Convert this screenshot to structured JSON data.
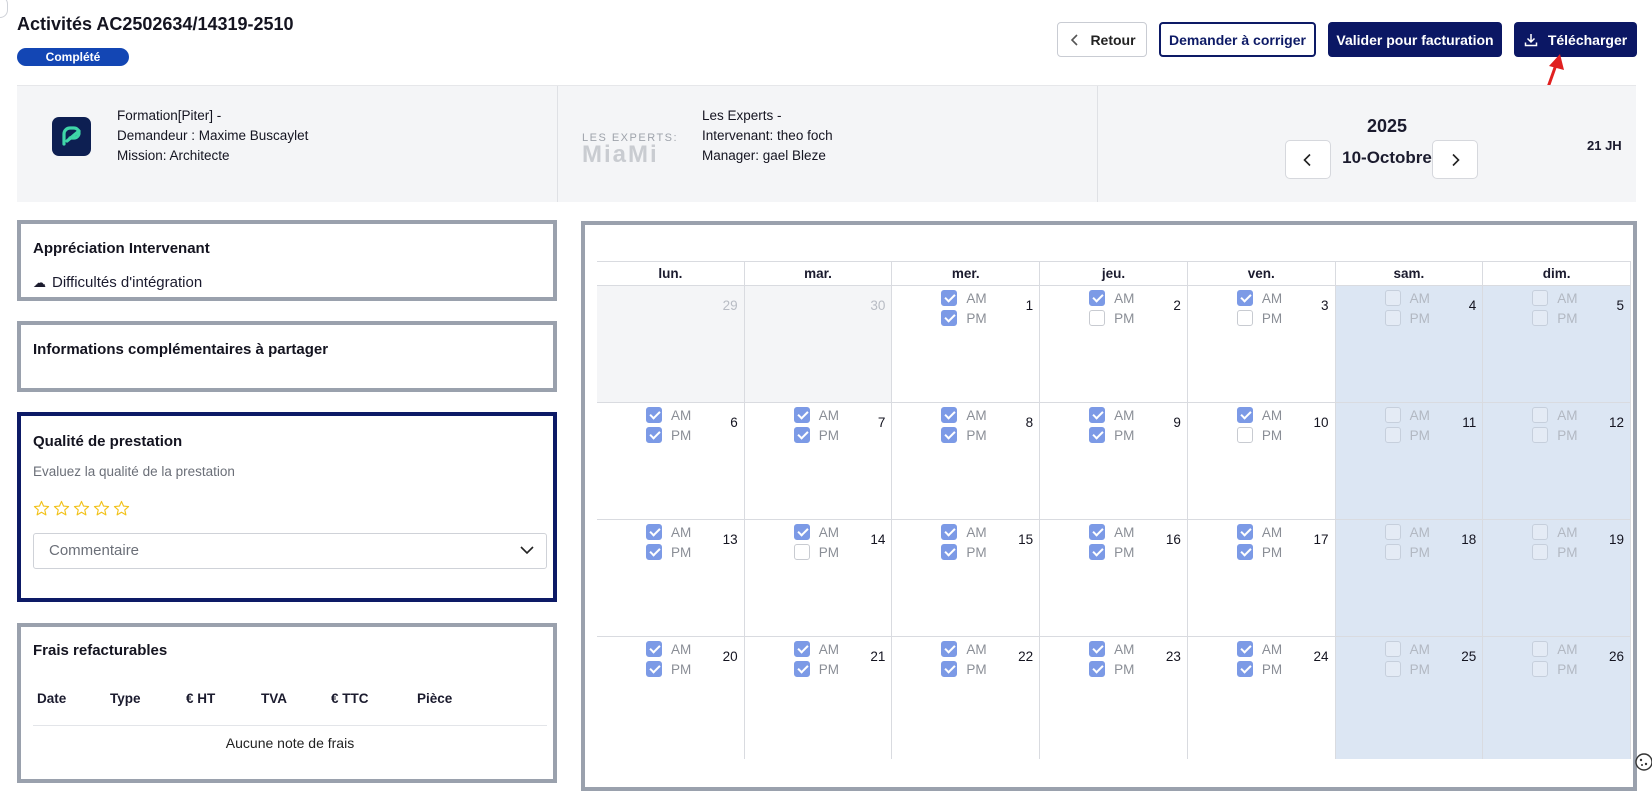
{
  "header": {
    "title": "Activités AC2502634/14319-2510",
    "status": "Complété",
    "buttons": {
      "retour": "Retour",
      "corriger": "Demander à corriger",
      "valider": "Valider pour facturation",
      "telecharger": "Télécharger"
    }
  },
  "info": {
    "client": {
      "line1": "Formation[Piter] -",
      "line2": "Demandeur : Maxime Buscaylet",
      "line3": "Mission: Architecte"
    },
    "provider": {
      "line1": "Les Experts -",
      "line2": "Intervenant: theo foch",
      "line3": "Manager: gael Bleze",
      "logo_text_top": "LES EXPERTS:",
      "logo_text_bottom": "MiaMi"
    },
    "period": {
      "year": "2025",
      "label": "10-Octobre",
      "total": "21 JH"
    }
  },
  "appreciation": {
    "title": "Appréciation Intervenant",
    "item_icon": "☁",
    "item": "Difficultés d'intégration"
  },
  "complementary": {
    "title": "Informations complémentaires à partager"
  },
  "quality": {
    "title": "Qualité de prestation",
    "subtitle": "Evaluez la qualité de la prestation",
    "rating": 0,
    "rating_max": 5,
    "comment_placeholder": "Commentaire"
  },
  "frais": {
    "title": "Frais refacturables",
    "columns": [
      "Date",
      "Type",
      "€ HT",
      "TVA",
      "€ TTC",
      "Pièce"
    ],
    "empty_text": "Aucune note de frais"
  },
  "calendar": {
    "days_of_week": [
      "lun.",
      "mar.",
      "mer.",
      "jeu.",
      "ven.",
      "sam.",
      "dim."
    ],
    "am_label": "AM",
    "pm_label": "PM",
    "weeks": [
      [
        {
          "day": "29",
          "other": true
        },
        {
          "day": "30",
          "other": true
        },
        {
          "day": "1",
          "am": true,
          "pm": true
        },
        {
          "day": "2",
          "am": true,
          "pm": false
        },
        {
          "day": "3",
          "am": true,
          "pm": false
        },
        {
          "day": "4",
          "am": false,
          "pm": false,
          "weekend": true
        },
        {
          "day": "5",
          "am": false,
          "pm": false,
          "weekend": true
        }
      ],
      [
        {
          "day": "6",
          "am": true,
          "pm": true
        },
        {
          "day": "7",
          "am": true,
          "pm": true
        },
        {
          "day": "8",
          "am": true,
          "pm": true
        },
        {
          "day": "9",
          "am": true,
          "pm": true
        },
        {
          "day": "10",
          "am": true,
          "pm": false
        },
        {
          "day": "11",
          "am": false,
          "pm": false,
          "weekend": true
        },
        {
          "day": "12",
          "am": false,
          "pm": false,
          "weekend": true
        }
      ],
      [
        {
          "day": "13",
          "am": true,
          "pm": true
        },
        {
          "day": "14",
          "am": true,
          "pm": false
        },
        {
          "day": "15",
          "am": true,
          "pm": true
        },
        {
          "day": "16",
          "am": true,
          "pm": true
        },
        {
          "day": "17",
          "am": true,
          "pm": true
        },
        {
          "day": "18",
          "am": false,
          "pm": false,
          "weekend": true
        },
        {
          "day": "19",
          "am": false,
          "pm": false,
          "weekend": true
        }
      ],
      [
        {
          "day": "20",
          "am": true,
          "pm": true
        },
        {
          "day": "21",
          "am": true,
          "pm": true
        },
        {
          "day": "22",
          "am": true,
          "pm": true
        },
        {
          "day": "23",
          "am": true,
          "pm": true
        },
        {
          "day": "24",
          "am": true,
          "pm": true
        },
        {
          "day": "25",
          "am": false,
          "pm": false,
          "weekend": true
        },
        {
          "day": "26",
          "am": false,
          "pm": false,
          "weekend": true
        }
      ]
    ]
  },
  "colors": {
    "primary": "#0b1764",
    "badge": "#1346b4",
    "checkbox_on": "#7c9ae6",
    "weekend": "#dce6f3",
    "annotation": "#e02020"
  }
}
